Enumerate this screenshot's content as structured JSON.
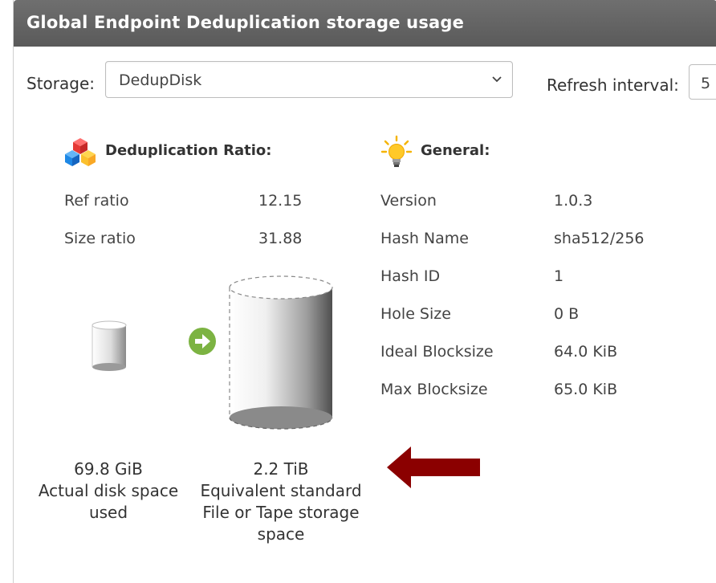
{
  "window": {
    "title": "Global Endpoint Deduplication storage usage"
  },
  "storage": {
    "label": "Storage:",
    "selected": "DedupDisk"
  },
  "refresh": {
    "label": "Refresh interval:",
    "value": "5"
  },
  "dedup": {
    "heading": "Deduplication Ratio:",
    "icon": "cubes-icon",
    "rows": [
      {
        "label": "Ref ratio",
        "value": "12.15"
      },
      {
        "label": "Size ratio",
        "value": "31.88"
      }
    ],
    "actual": {
      "value": "69.8 GiB",
      "lines": [
        "Actual disk space",
        "used"
      ]
    },
    "equivalent": {
      "value": "2.2 TiB",
      "lines": [
        "Equivalent standard",
        "File or Tape storage",
        "space"
      ]
    }
  },
  "general": {
    "heading": "General:",
    "icon": "lightbulb-icon",
    "rows": [
      {
        "label": "Version",
        "value": "1.0.3"
      },
      {
        "label": "Hash Name",
        "value": "sha512/256"
      },
      {
        "label": "Hash ID",
        "value": "1"
      },
      {
        "label": "Hole Size",
        "value": "0 B"
      },
      {
        "label": "Ideal Blocksize",
        "value": "64.0 KiB"
      },
      {
        "label": "Max Blocksize",
        "value": "65.0 KiB"
      }
    ]
  },
  "colors": {
    "titlebar": "#5f5f5f",
    "arrow_green": "#7cb342",
    "annotation_arrow": "#8b0000"
  }
}
